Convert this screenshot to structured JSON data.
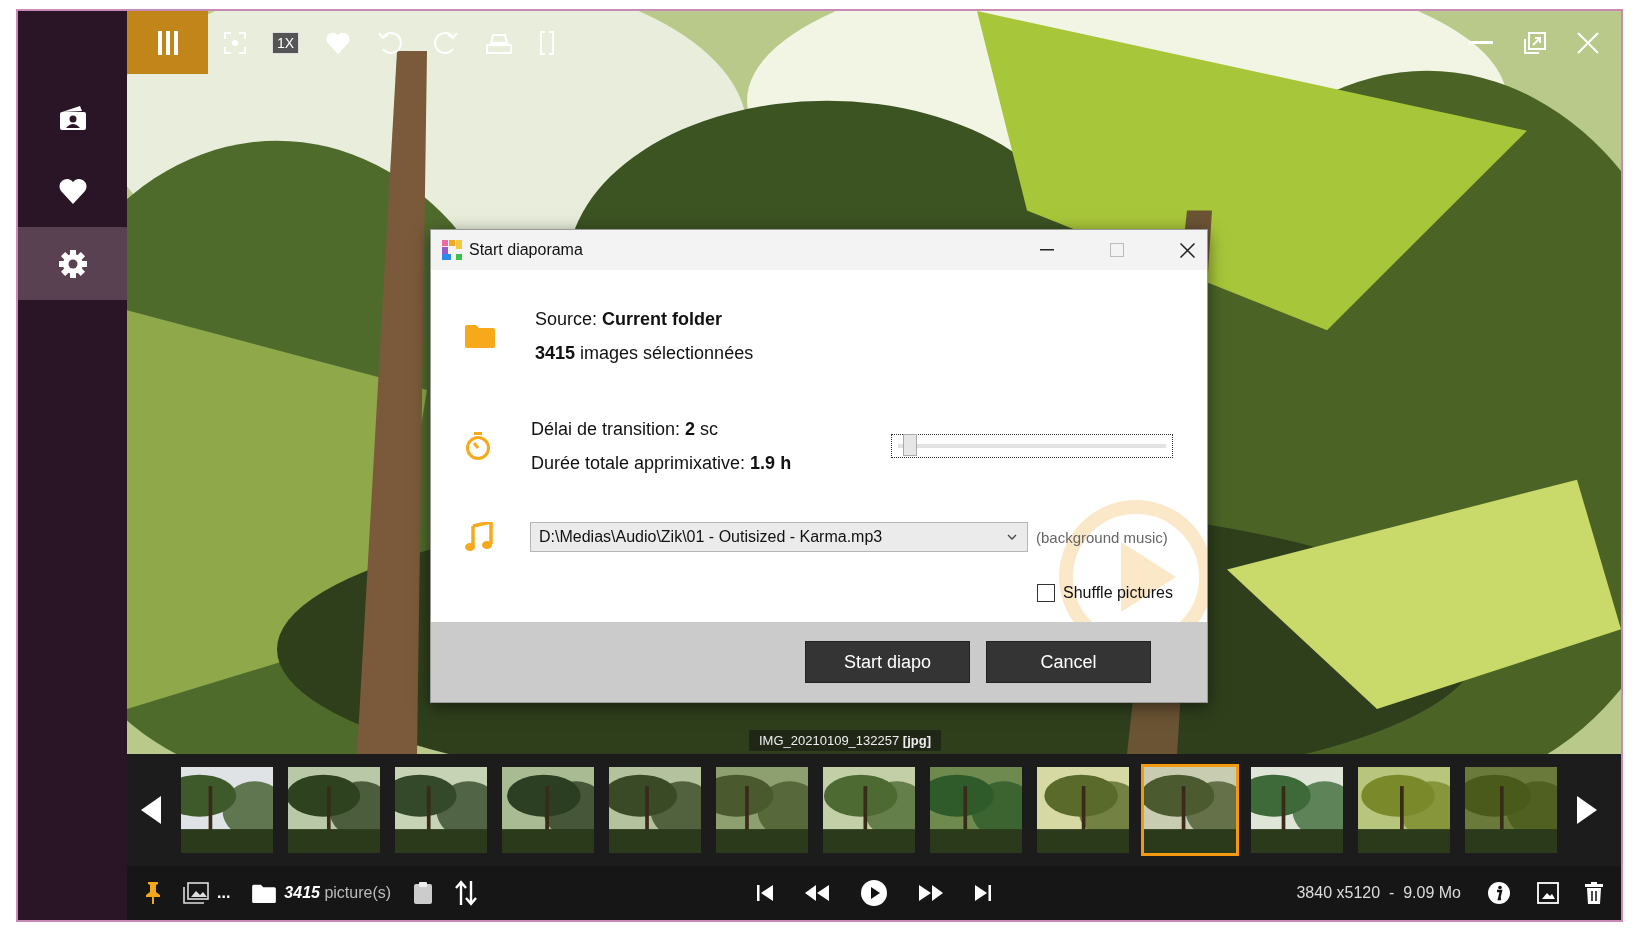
{
  "sidebar": {
    "items": [
      {
        "kind": "contacts",
        "selected": false
      },
      {
        "kind": "favorites",
        "selected": false
      },
      {
        "kind": "settings",
        "selected": true
      }
    ]
  },
  "toolbar": {
    "zoom_label": "1X"
  },
  "dialog": {
    "title": "Start diaporama",
    "source": "Source: **Current folder**",
    "count": "**3415** images sélectionnées",
    "delay": "Délai de transition: **2** sc",
    "duration": "Durée totale apprimixative: **1.9 h**",
    "delay_slider": {
      "level": 0.02
    },
    "music": {
      "value": "D:\\Medias\\Audio\\Zik\\01 - Outisized - Karma.mp3",
      "hint": "(background music)"
    },
    "shuffle": {
      "label": "Shuffle pictures",
      "checked": false
    },
    "buttons": [
      {
        "label": "Start diapo"
      },
      {
        "label": "Cancel"
      }
    ]
  },
  "filename": "IMG_20210109_132257 **[jpg]**",
  "thumbnails": [
    {
      "selected": false
    },
    {
      "selected": false
    },
    {
      "selected": false
    },
    {
      "selected": false
    },
    {
      "selected": false
    },
    {
      "selected": false
    },
    {
      "selected": false
    },
    {
      "selected": false
    },
    {
      "selected": false
    },
    {
      "selected": true
    },
    {
      "selected": false
    },
    {
      "selected": false
    },
    {
      "selected": false
    }
  ],
  "status_bar": {
    "more": "...",
    "count": "3415",
    "count_label": "picture(s)",
    "info": "3840 x5120  -  9.09 Mo"
  }
}
